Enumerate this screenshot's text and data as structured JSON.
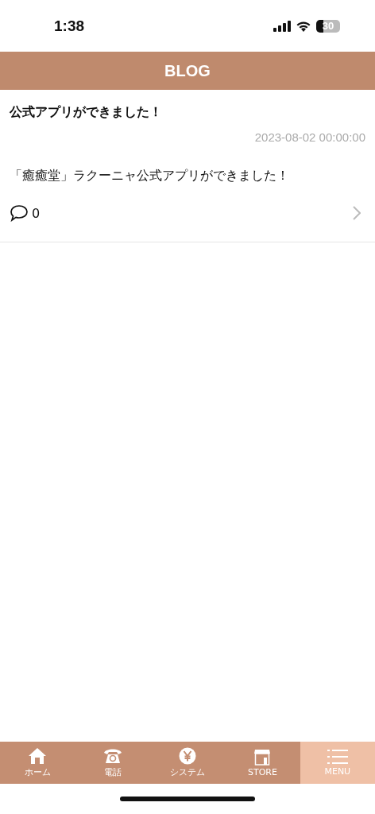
{
  "status_bar": {
    "time": "1:38",
    "battery": "30"
  },
  "header": {
    "title": "BLOG"
  },
  "posts": [
    {
      "title": "公式アプリができました！",
      "date": "2023-08-02 00:00:00",
      "body": "「癒癒堂」ラクーニャ公式アプリができました！",
      "comments": "0"
    }
  ],
  "tab_bar": [
    {
      "kind": "home",
      "label": "ホーム",
      "selected": false
    },
    {
      "kind": "phone",
      "label": "電話",
      "selected": false
    },
    {
      "kind": "yen",
      "label": "システム",
      "selected": false
    },
    {
      "kind": "store",
      "label": "STORE",
      "selected": false
    },
    {
      "kind": "menu",
      "label": "MENU",
      "selected": true
    }
  ]
}
